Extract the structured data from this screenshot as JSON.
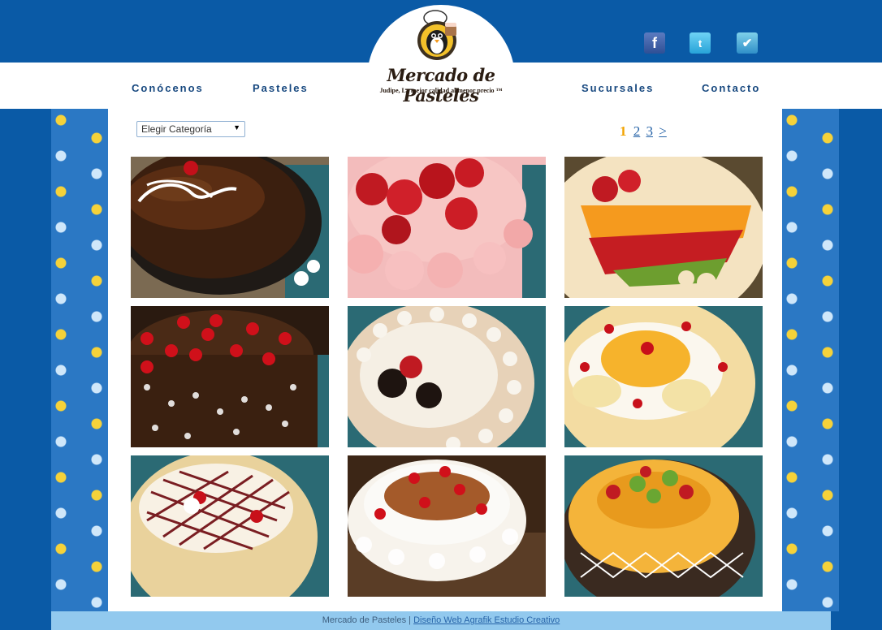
{
  "nav": {
    "left": [
      "Conócenos",
      "Pasteles"
    ],
    "right": [
      "Sucursales",
      "Contacto"
    ]
  },
  "social": [
    "facebook-icon",
    "twitter-icon",
    "foursquare-icon"
  ],
  "logo": {
    "name": "Mercado de Pasteles",
    "tagline": "Judipe, La mejor calidad al menor precio ™"
  },
  "filter": {
    "selected": "Elegir Categoría"
  },
  "pagination": {
    "current": "1",
    "pages": [
      "2",
      "3"
    ],
    "next": ">"
  },
  "products": [
    "chocolate-cake",
    "strawberry-cream-cake",
    "fruit-cake",
    "black-forest-cake",
    "oreo-cake",
    "peach-cherry-cake",
    "lattice-cake",
    "cherry-chocolate-cake",
    "peach-kiwi-cake"
  ],
  "footer": {
    "text": "Mercado de Pasteles | ",
    "link": "Diseño Web Agrafik Estudio Creativo"
  }
}
